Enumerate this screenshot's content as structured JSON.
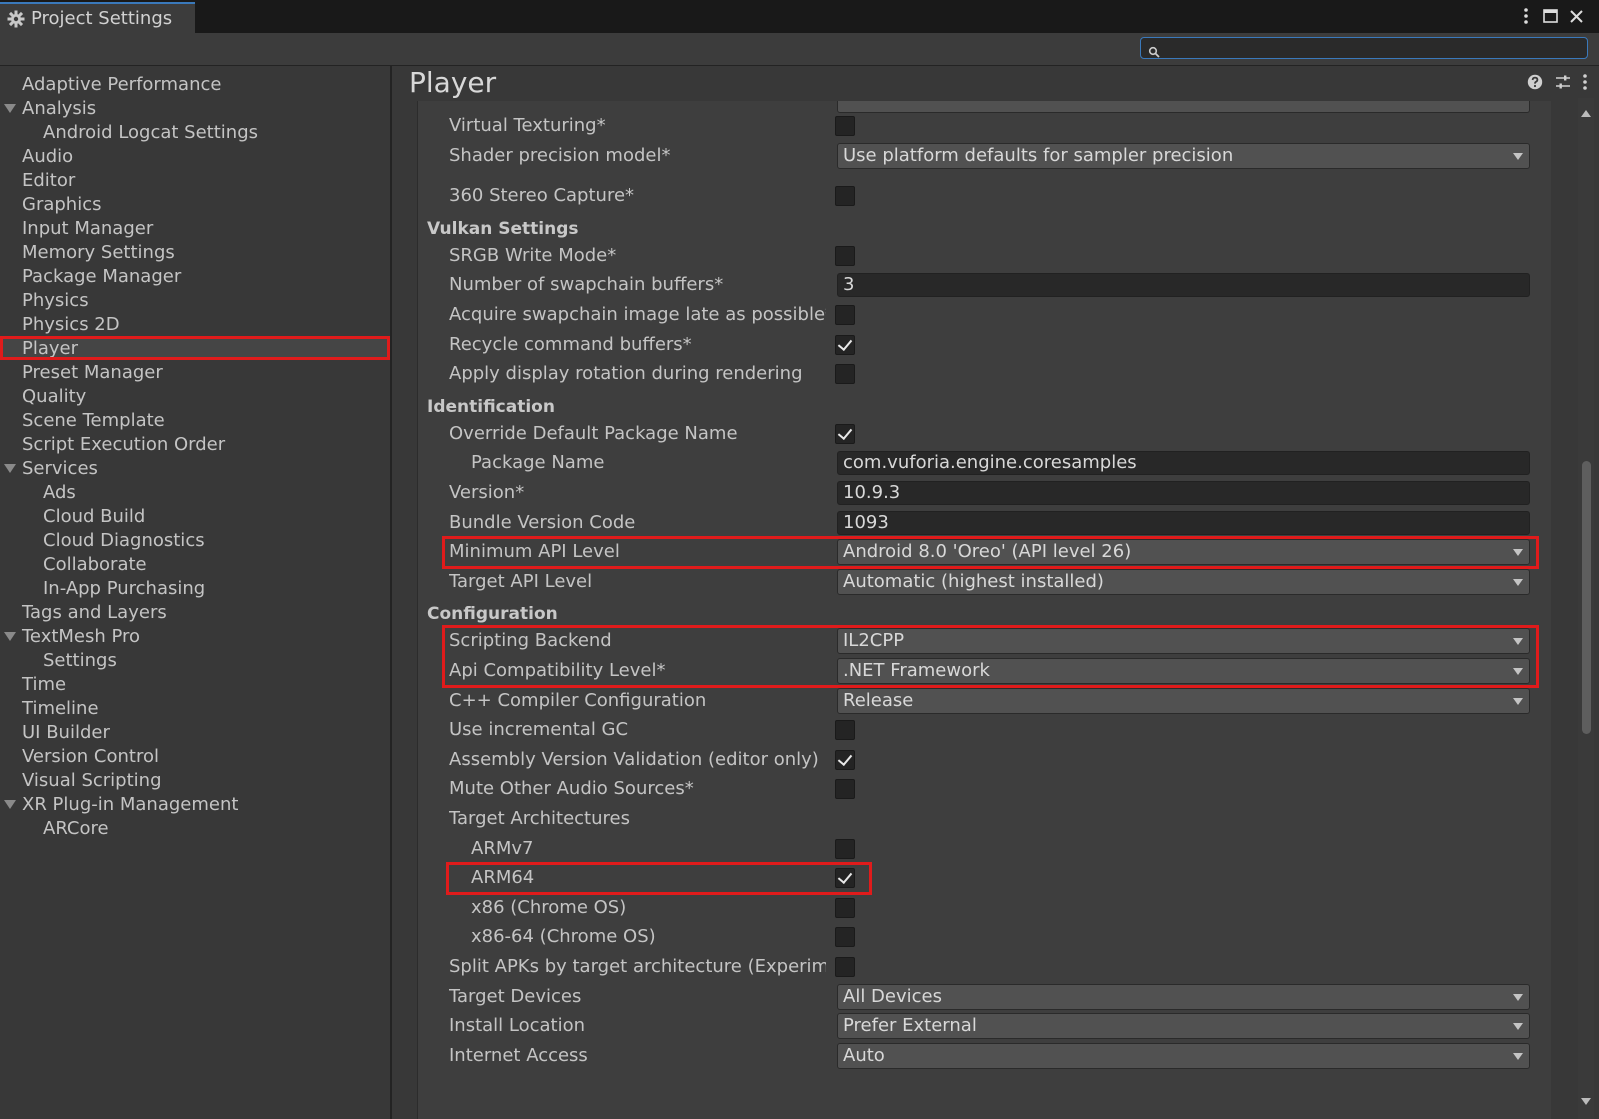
{
  "window": {
    "tab_title": "Project Settings",
    "controls": [
      "more-icon",
      "maximize-icon",
      "close-icon"
    ]
  },
  "search": {
    "placeholder": "",
    "value": ""
  },
  "sidebar": {
    "items": [
      {
        "label": "Adaptive Performance",
        "indent": 0
      },
      {
        "label": "Analysis",
        "indent": 0,
        "expanded": true
      },
      {
        "label": "Android Logcat Settings",
        "indent": 1
      },
      {
        "label": "Audio",
        "indent": 0
      },
      {
        "label": "Editor",
        "indent": 0
      },
      {
        "label": "Graphics",
        "indent": 0
      },
      {
        "label": "Input Manager",
        "indent": 0
      },
      {
        "label": "Memory Settings",
        "indent": 0
      },
      {
        "label": "Package Manager",
        "indent": 0
      },
      {
        "label": "Physics",
        "indent": 0
      },
      {
        "label": "Physics 2D",
        "indent": 0
      },
      {
        "label": "Player",
        "indent": 0,
        "selected": true
      },
      {
        "label": "Preset Manager",
        "indent": 0
      },
      {
        "label": "Quality",
        "indent": 0
      },
      {
        "label": "Scene Template",
        "indent": 0
      },
      {
        "label": "Script Execution Order",
        "indent": 0
      },
      {
        "label": "Services",
        "indent": 0,
        "expanded": true
      },
      {
        "label": "Ads",
        "indent": 1
      },
      {
        "label": "Cloud Build",
        "indent": 1
      },
      {
        "label": "Cloud Diagnostics",
        "indent": 1
      },
      {
        "label": "Collaborate",
        "indent": 1
      },
      {
        "label": "In-App Purchasing",
        "indent": 1
      },
      {
        "label": "Tags and Layers",
        "indent": 0
      },
      {
        "label": "TextMesh Pro",
        "indent": 0,
        "expanded": true
      },
      {
        "label": "Settings",
        "indent": 1
      },
      {
        "label": "Time",
        "indent": 0
      },
      {
        "label": "Timeline",
        "indent": 0
      },
      {
        "label": "UI Builder",
        "indent": 0
      },
      {
        "label": "Version Control",
        "indent": 0
      },
      {
        "label": "Visual Scripting",
        "indent": 0
      },
      {
        "label": "XR Plug-in Management",
        "indent": 0,
        "expanded": true
      },
      {
        "label": "ARCore",
        "indent": 1
      }
    ]
  },
  "main": {
    "title": "Player",
    "header_icons": [
      "help-icon",
      "preset-icon",
      "more-icon"
    ],
    "rows": [
      {
        "kind": "checkbox",
        "label": "Virtual Texturing*",
        "checked": false,
        "indent": 1
      },
      {
        "kind": "dropdown",
        "label": "Shader precision model*",
        "value": "Use platform defaults for sampler precision",
        "indent": 1
      },
      {
        "kind": "checkbox",
        "label": "360 Stereo Capture*",
        "checked": false,
        "indent": 1
      },
      {
        "kind": "section",
        "label": "Vulkan Settings"
      },
      {
        "kind": "checkbox",
        "label": "SRGB Write Mode*",
        "checked": false,
        "indent": 1
      },
      {
        "kind": "text",
        "label": "Number of swapchain buffers*",
        "value": "3",
        "indent": 1
      },
      {
        "kind": "checkbox",
        "label": "Acquire swapchain image late as possible*",
        "checked": false,
        "indent": 1
      },
      {
        "kind": "checkbox",
        "label": "Recycle command buffers*",
        "checked": true,
        "indent": 1
      },
      {
        "kind": "checkbox",
        "label": "Apply display rotation during rendering",
        "checked": false,
        "indent": 1
      },
      {
        "kind": "section",
        "label": "Identification"
      },
      {
        "kind": "checkbox",
        "label": "Override Default Package Name",
        "checked": true,
        "indent": 1
      },
      {
        "kind": "text",
        "label": "Package Name",
        "value": "com.vuforia.engine.coresamples",
        "indent": 2
      },
      {
        "kind": "text",
        "label": "Version*",
        "value": "10.9.3",
        "indent": 1
      },
      {
        "kind": "text",
        "label": "Bundle Version Code",
        "value": "1093",
        "indent": 1
      },
      {
        "kind": "dropdown",
        "label": "Minimum API Level",
        "value": "Android 8.0 'Oreo' (API level 26)",
        "indent": 1,
        "highlighted": true
      },
      {
        "kind": "dropdown",
        "label": "Target API Level",
        "value": "Automatic (highest installed)",
        "indent": 1
      },
      {
        "kind": "section",
        "label": "Configuration"
      },
      {
        "kind": "dropdown",
        "label": "Scripting Backend",
        "value": "IL2CPP",
        "indent": 1,
        "highlighted": true
      },
      {
        "kind": "dropdown",
        "label": "Api Compatibility Level*",
        "value": ".NET Framework",
        "indent": 1,
        "highlighted": true
      },
      {
        "kind": "dropdown",
        "label": "C++ Compiler Configuration",
        "value": "Release",
        "indent": 1
      },
      {
        "kind": "checkbox",
        "label": "Use incremental GC",
        "checked": false,
        "indent": 1
      },
      {
        "kind": "checkbox",
        "label": "Assembly Version Validation (editor only)",
        "checked": true,
        "indent": 1
      },
      {
        "kind": "checkbox",
        "label": "Mute Other Audio Sources*",
        "checked": false,
        "indent": 1
      },
      {
        "kind": "label",
        "label": "Target Architectures",
        "indent": 1
      },
      {
        "kind": "checkbox",
        "label": "ARMv7",
        "checked": false,
        "indent": 2
      },
      {
        "kind": "checkbox",
        "label": "ARM64",
        "checked": true,
        "indent": 2,
        "highlighted": true
      },
      {
        "kind": "checkbox",
        "label": "x86 (Chrome OS)",
        "checked": false,
        "indent": 2
      },
      {
        "kind": "checkbox",
        "label": "x86-64 (Chrome OS)",
        "checked": false,
        "indent": 2
      },
      {
        "kind": "checkbox",
        "label": "Split APKs by target architecture (Experimental)",
        "checked": false,
        "indent": 1
      },
      {
        "kind": "dropdown",
        "label": "Target Devices",
        "value": "All Devices",
        "indent": 1
      },
      {
        "kind": "dropdown",
        "label": "Install Location",
        "value": "Prefer External",
        "indent": 1
      },
      {
        "kind": "dropdown",
        "label": "Internet Access",
        "value": "Auto",
        "indent": 1
      }
    ]
  },
  "colors": {
    "background": "#383838",
    "panel": "#3e3e3e",
    "titlebar": "#191919",
    "highlight": "#e01b1b",
    "accent": "#3a79bb"
  }
}
